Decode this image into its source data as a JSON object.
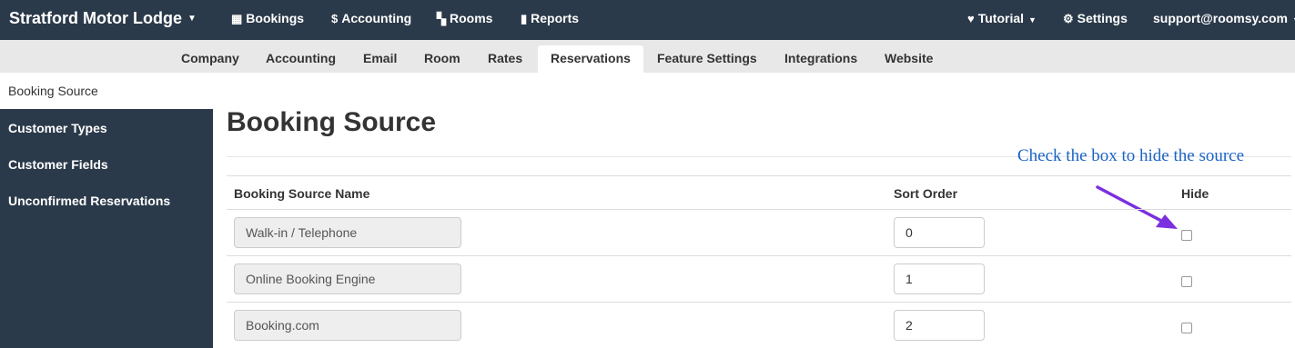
{
  "topnav": {
    "brand": "Stratford Motor Lodge",
    "items": [
      {
        "icon": "calendar-icon",
        "glyph": "▦",
        "label": "Bookings"
      },
      {
        "icon": "dollar-icon",
        "glyph": "$",
        "label": "Accounting"
      },
      {
        "icon": "grid-icon",
        "glyph": "▚",
        "label": "Rooms"
      },
      {
        "icon": "bar-chart-icon",
        "glyph": "▮",
        "label": "Reports"
      }
    ],
    "right": [
      {
        "icon": "heart-icon",
        "glyph": "♥",
        "label": "Tutorial"
      },
      {
        "icon": "gear-icon",
        "glyph": "⚙",
        "label": "Settings"
      },
      {
        "label": "support@roomsy.com"
      }
    ]
  },
  "tabs": [
    "Company",
    "Accounting",
    "Email",
    "Room",
    "Rates",
    "Reservations",
    "Feature Settings",
    "Integrations",
    "Website"
  ],
  "active_tab": "Reservations",
  "sidebar": {
    "active": "Booking Source",
    "items": [
      "Customer Types",
      "Customer Fields",
      "Unconfirmed Reservations"
    ]
  },
  "page": {
    "title": "Booking Source",
    "callout": "Check the box to hide the source"
  },
  "table": {
    "headers": {
      "name": "Booking Source Name",
      "order": "Sort Order",
      "hide": "Hide"
    },
    "rows": [
      {
        "name": "Walk-in / Telephone",
        "order": "0",
        "hidden": false
      },
      {
        "name": "Online Booking Engine",
        "order": "1",
        "hidden": false
      },
      {
        "name": "Booking.com",
        "order": "2",
        "hidden": false
      }
    ]
  },
  "colors": {
    "nav_bg": "#2b3a4a",
    "callout": "#1a63c7",
    "arrow": "#7b2fe0"
  }
}
